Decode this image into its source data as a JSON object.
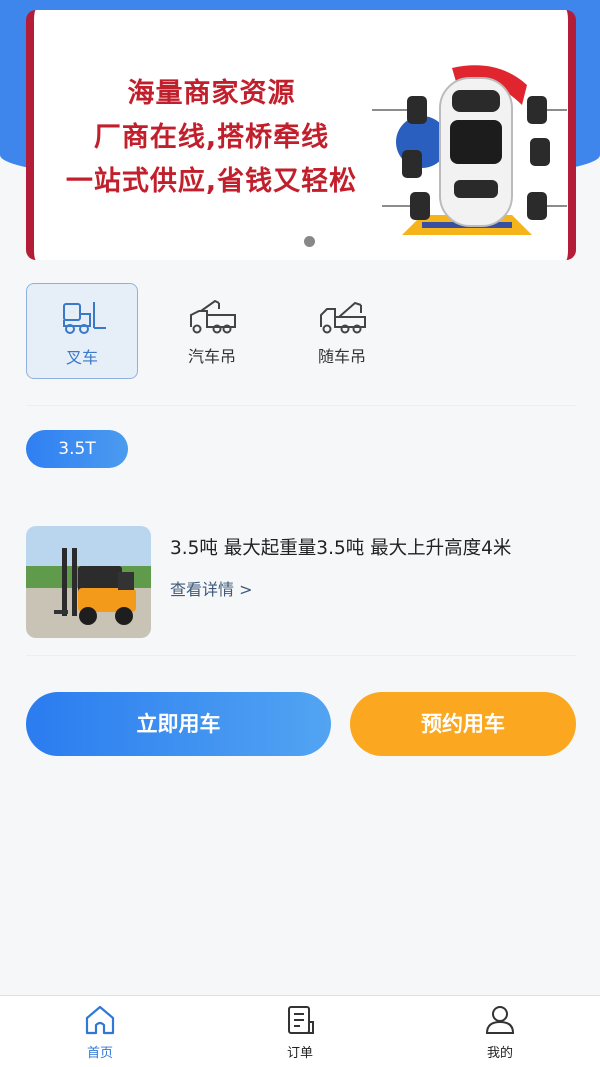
{
  "banner": {
    "lines": [
      "海量商家资源",
      "厂商在线,搭桥牵线",
      "一站式供应,省钱又轻松"
    ],
    "accent_color": "#c21f2c",
    "border_color": "#b41d37"
  },
  "categories": [
    {
      "label": "叉车",
      "icon": "forklift-icon",
      "active": true
    },
    {
      "label": "汽车吊",
      "icon": "crane-truck-icon",
      "active": false
    },
    {
      "label": "随车吊",
      "icon": "truck-mounted-crane-icon",
      "active": false
    }
  ],
  "spec_tag": "3.5T",
  "product": {
    "title": "3.5吨  最大起重量3.5吨  最大上升高度4米",
    "link": "查看详情 >"
  },
  "actions": {
    "now_label": "立即用车",
    "book_label": "预约用车"
  },
  "tabbar": {
    "items": [
      {
        "label": "首页",
        "icon": "home-icon",
        "active": true
      },
      {
        "label": "订单",
        "icon": "order-icon",
        "active": false
      },
      {
        "label": "我的",
        "icon": "profile-icon",
        "active": false
      }
    ]
  },
  "colors": {
    "primary": "#2f7ff2",
    "secondary": "#fba820",
    "header_bg": "#3f86ec"
  }
}
